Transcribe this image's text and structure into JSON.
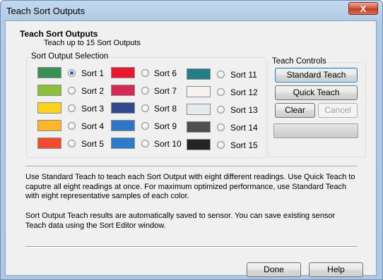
{
  "window": {
    "title": "Teach Sort Outputs",
    "close_label": "X"
  },
  "header": {
    "title": "Teach Sort Outputs",
    "subtitle": "Teach up to 15 Sort Outputs"
  },
  "sort_group": {
    "label": "Sort Output Selection",
    "selected": "Sort 1",
    "items": [
      {
        "label": "Sort 1",
        "color": "#3a8f55",
        "selected": true
      },
      {
        "label": "Sort 2",
        "color": "#8dc03a",
        "selected": false
      },
      {
        "label": "Sort 3",
        "color": "#ffd21c",
        "selected": false
      },
      {
        "label": "Sort 4",
        "color": "#ffb52a",
        "selected": false
      },
      {
        "label": "Sort 5",
        "color": "#f14b31",
        "selected": false
      },
      {
        "label": "Sort 6",
        "color": "#e8182e",
        "selected": false
      },
      {
        "label": "Sort 7",
        "color": "#d52a55",
        "selected": false
      },
      {
        "label": "Sort 8",
        "color": "#324a8d",
        "selected": false
      },
      {
        "label": "Sort 9",
        "color": "#2e76c4",
        "selected": false
      },
      {
        "label": "Sort 10",
        "color": "#2f7bcb",
        "selected": false
      },
      {
        "label": "Sort 11",
        "color": "#217f83",
        "selected": false
      },
      {
        "label": "Sort 12",
        "color": "#f8f2f1",
        "selected": false
      },
      {
        "label": "Sort 13",
        "color": "#e5eaed",
        "selected": false
      },
      {
        "label": "Sort 14",
        "color": "#4f4f50",
        "selected": false
      },
      {
        "label": "Sort 15",
        "color": "#242424",
        "selected": false
      }
    ]
  },
  "teach_controls": {
    "label": "Teach Controls",
    "standard_teach": "Standard Teach",
    "quick_teach": "Quick Teach",
    "clear": "Clear",
    "cancel": "Cancel"
  },
  "description": {
    "para1": "Use Standard Teach to teach each Sort Output with eight different readings. Use Quick Teach to caputre all eight readings at once. For maximum optimized performance, use Standard Teach with eight representative samples of each color.",
    "para2": "Sort Output Teach results are automatically saved to sensor.  You can save existing sensor Teach data using the Sort Editor window."
  },
  "footer": {
    "done": "Done",
    "help": "Help"
  }
}
